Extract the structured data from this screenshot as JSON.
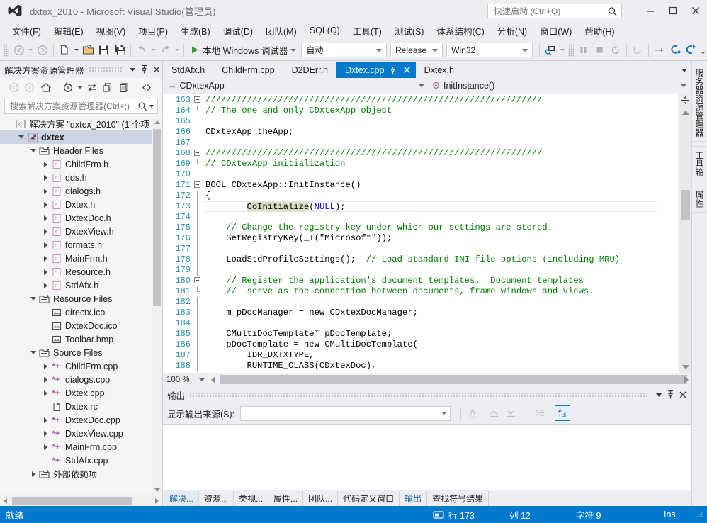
{
  "window": {
    "title": "dxtex_2010 - Microsoft Visual Studio(管理员)",
    "logo_name": "visual-studio-logo"
  },
  "quick_launch": {
    "placeholder": "快速启动 (Ctrl+Q)",
    "value": ""
  },
  "window_buttons": {
    "minimize": "–",
    "maximize": "☐",
    "close": "✕"
  },
  "menu": {
    "items": [
      {
        "label": "文件(F)"
      },
      {
        "label": "编辑(E)"
      },
      {
        "label": "视图(V)"
      },
      {
        "label": "项目(P)"
      },
      {
        "label": "生成(B)"
      },
      {
        "label": "调试(D)"
      },
      {
        "label": "团队(M)"
      },
      {
        "label": "SQL(Q)"
      },
      {
        "label": "工具(T)"
      },
      {
        "label": "测试(S)"
      },
      {
        "label": "体系结构(C)"
      },
      {
        "label": "分析(N)"
      },
      {
        "label": "窗口(W)"
      },
      {
        "label": "帮助(H)"
      }
    ]
  },
  "toolbar": {
    "run_label": "本地 Windows 调试器",
    "config_value": "自动",
    "build_config": "Release",
    "platform": "Win32",
    "icons": [
      "navigate-backward-icon",
      "navigate-forward-icon",
      "new-project-icon",
      "open-file-icon",
      "save-icon",
      "save-all-icon",
      "undo-icon",
      "redo-icon",
      "start-debug-icon",
      "attach-process-icon",
      "pause-icon",
      "stop-icon",
      "restart-icon",
      "hot-reload-icon",
      "step-over-icon",
      "step-into-icon",
      "step-out-icon"
    ]
  },
  "solution_explorer": {
    "title": "解决方案资源管理器",
    "search_placeholder": "搜索解决方案资源管理器(Ctrl+;)",
    "toolbar_icons": [
      "back-icon",
      "forward-icon",
      "home-icon",
      "pending-changes-icon",
      "sync-with-active-document-icon",
      "refresh-icon",
      "collapse-all-icon",
      "show-all-files-icon",
      "properties-icon",
      "overflow-icon"
    ],
    "header_icons": [
      "panel-dropdown-icon",
      "pin-icon",
      "close-icon"
    ],
    "tree": [
      {
        "label": "解决方案 \"dxtex_2010\" (1 个项",
        "depth": 0,
        "icon": "solution-icon",
        "twisty": "none",
        "bold": false,
        "selected": false
      },
      {
        "label": "dxtex",
        "depth": 1,
        "icon": "project-icon",
        "twisty": "down",
        "bold": true,
        "selected": true
      },
      {
        "label": "Header Files",
        "depth": 2,
        "icon": "folder-icon",
        "twisty": "down",
        "bold": false,
        "selected": false
      },
      {
        "label": "ChildFrm.h",
        "depth": 3,
        "icon": "header-file-icon",
        "twisty": "right",
        "bold": false,
        "selected": false
      },
      {
        "label": "dds.h",
        "depth": 3,
        "icon": "header-file-icon",
        "twisty": "right",
        "bold": false,
        "selected": false
      },
      {
        "label": "dialogs.h",
        "depth": 3,
        "icon": "header-file-icon",
        "twisty": "right",
        "bold": false,
        "selected": false
      },
      {
        "label": "Dxtex.h",
        "depth": 3,
        "icon": "header-file-icon",
        "twisty": "right",
        "bold": false,
        "selected": false
      },
      {
        "label": "DxtexDoc.h",
        "depth": 3,
        "icon": "header-file-icon",
        "twisty": "right",
        "bold": false,
        "selected": false
      },
      {
        "label": "DxtexView.h",
        "depth": 3,
        "icon": "header-file-icon",
        "twisty": "right",
        "bold": false,
        "selected": false
      },
      {
        "label": "formats.h",
        "depth": 3,
        "icon": "header-file-icon",
        "twisty": "right",
        "bold": false,
        "selected": false
      },
      {
        "label": "MainFrm.h",
        "depth": 3,
        "icon": "header-file-icon",
        "twisty": "right",
        "bold": false,
        "selected": false
      },
      {
        "label": "Resource.h",
        "depth": 3,
        "icon": "header-file-icon",
        "twisty": "right",
        "bold": false,
        "selected": false
      },
      {
        "label": "StdAfx.h",
        "depth": 3,
        "icon": "header-file-icon",
        "twisty": "right",
        "bold": false,
        "selected": false
      },
      {
        "label": "Resource Files",
        "depth": 2,
        "icon": "folder-icon",
        "twisty": "down",
        "bold": false,
        "selected": false
      },
      {
        "label": "directx.ico",
        "depth": 3,
        "icon": "image-file-icon",
        "twisty": "none",
        "bold": false,
        "selected": false
      },
      {
        "label": "DxtexDoc.ico",
        "depth": 3,
        "icon": "image-file-icon",
        "twisty": "none",
        "bold": false,
        "selected": false
      },
      {
        "label": "Toolbar.bmp",
        "depth": 3,
        "icon": "image-file-icon",
        "twisty": "none",
        "bold": false,
        "selected": false
      },
      {
        "label": "Source Files",
        "depth": 2,
        "icon": "folder-icon",
        "twisty": "down",
        "bold": false,
        "selected": false
      },
      {
        "label": "ChildFrm.cpp",
        "depth": 3,
        "icon": "cpp-file-icon",
        "twisty": "right",
        "bold": false,
        "selected": false
      },
      {
        "label": "dialogs.cpp",
        "depth": 3,
        "icon": "cpp-file-icon",
        "twisty": "right",
        "bold": false,
        "selected": false
      },
      {
        "label": "Dxtex.cpp",
        "depth": 3,
        "icon": "cpp-file-icon",
        "twisty": "right",
        "bold": false,
        "selected": false
      },
      {
        "label": "Dxtex.rc",
        "depth": 3,
        "icon": "resource-file-icon",
        "twisty": "none",
        "bold": false,
        "selected": false
      },
      {
        "label": "DxtexDoc.cpp",
        "depth": 3,
        "icon": "cpp-file-icon",
        "twisty": "right",
        "bold": false,
        "selected": false
      },
      {
        "label": "DxtexView.cpp",
        "depth": 3,
        "icon": "cpp-file-icon",
        "twisty": "right",
        "bold": false,
        "selected": false
      },
      {
        "label": "MainFrm.cpp",
        "depth": 3,
        "icon": "cpp-file-icon",
        "twisty": "right",
        "bold": false,
        "selected": false
      },
      {
        "label": "StdAfx.cpp",
        "depth": 3,
        "icon": "cpp-file-icon",
        "twisty": "none",
        "bold": false,
        "selected": false
      },
      {
        "label": "外部依赖项",
        "depth": 2,
        "icon": "folder-icon",
        "twisty": "right",
        "bold": false,
        "selected": false
      }
    ]
  },
  "editor": {
    "tabs": [
      {
        "label": "StdAfx.h",
        "active": false
      },
      {
        "label": "ChildFrm.cpp",
        "active": false
      },
      {
        "label": "D2DErr.h",
        "active": false
      },
      {
        "label": "Dxtex.cpp",
        "active": true
      },
      {
        "label": "Dxtex.h",
        "active": false
      }
    ],
    "tab_pin_icon": "pin-icon",
    "tab_close_icon": "close-icon",
    "tab_overflow_icon": "tab-list-dropdown-icon",
    "nav_class": "CDxtexApp",
    "nav_member": "InitInstance()",
    "zoom": "100 %",
    "first_line": 163,
    "lines": [
      {
        "no": 163,
        "fold": "box",
        "text": "/////////////////////////////////////////////////////////////////"
      },
      {
        "no": 164,
        "fold": "end",
        "text": "// The one and only CDxtexApp object"
      },
      {
        "no": 165,
        "fold": "",
        "text": ""
      },
      {
        "no": 166,
        "fold": "",
        "text": "CDxtexApp theApp;"
      },
      {
        "no": 167,
        "fold": "",
        "text": ""
      },
      {
        "no": 168,
        "fold": "box",
        "text": "/////////////////////////////////////////////////////////////////"
      },
      {
        "no": 169,
        "fold": "end",
        "text": "// CDxtexApp initialization"
      },
      {
        "no": 170,
        "fold": "",
        "text": ""
      },
      {
        "no": 171,
        "fold": "box",
        "text": "BOOL CDxtexApp::InitInstance()"
      },
      {
        "no": 172,
        "fold": "line",
        "text": "{"
      },
      {
        "no": 173,
        "fold": "line",
        "text": "    CoInitialize(NULL);"
      },
      {
        "no": 174,
        "fold": "line",
        "text": ""
      },
      {
        "no": 175,
        "fold": "line",
        "text": "    // Change the registry key under which our settings are stored."
      },
      {
        "no": 176,
        "fold": "line",
        "text": "    SetRegistryKey(_T(\"Microsoft\"));"
      },
      {
        "no": 177,
        "fold": "line",
        "text": ""
      },
      {
        "no": 178,
        "fold": "line",
        "text": "    LoadStdProfileSettings();  // Load standard INI file options (including MRU)"
      },
      {
        "no": 179,
        "fold": "line",
        "text": ""
      },
      {
        "no": 180,
        "fold": "box",
        "text": "    // Register the application's document templates.  Document templates"
      },
      {
        "no": 181,
        "fold": "end",
        "text": "    //  serve as the connection between documents, frame windows and views."
      },
      {
        "no": 182,
        "fold": "line",
        "text": ""
      },
      {
        "no": 183,
        "fold": "line",
        "text": "    m_pDocManager = new CDxtexDocManager;"
      },
      {
        "no": 184,
        "fold": "line",
        "text": ""
      },
      {
        "no": 185,
        "fold": "line",
        "text": "    CMultiDocTemplate* pDocTemplate;"
      },
      {
        "no": 186,
        "fold": "line",
        "text": "    pDocTemplate = new CMultiDocTemplate("
      },
      {
        "no": 187,
        "fold": "line",
        "text": "        IDR_DXTXTYPE,"
      },
      {
        "no": 188,
        "fold": "line",
        "text": "        RUNTIME_CLASS(CDxtexDoc),"
      }
    ],
    "cursor": {
      "line": 173,
      "col": 12
    },
    "highlighted_word": "CoInitialize"
  },
  "output_panel": {
    "title": "输出",
    "source_label": "显示输出来源(S):",
    "source_value": "",
    "header_icons": [
      "panel-dropdown-icon",
      "pin-icon",
      "close-icon"
    ],
    "toolbar_icons": [
      "clear-all-icon",
      "goto-previous-message-icon",
      "goto-next-message-icon",
      "toggle-output-wrap-icon",
      "word-wrap-icon"
    ],
    "content": ""
  },
  "bottom_tabs": [
    {
      "label": "解决...",
      "state": "selected"
    },
    {
      "label": "资源...",
      "state": "normal"
    },
    {
      "label": "类视...",
      "state": "normal"
    },
    {
      "label": "属性...",
      "state": "normal"
    },
    {
      "label": "团队...",
      "state": "normal"
    },
    {
      "label": "代码定义窗口",
      "state": "normal"
    },
    {
      "label": "输出",
      "state": "link"
    },
    {
      "label": "查找符号结果",
      "state": "normal"
    }
  ],
  "right_tabs": [
    {
      "label": "服务器资源管理器"
    },
    {
      "label": "工具箱"
    },
    {
      "label": "属性"
    }
  ],
  "status_bar": {
    "ready": "就绪",
    "line_label": "行 173",
    "col_label": "列 12",
    "char_label": "字符 9",
    "insert_mode": "Ins",
    "caret_icon": "caret-position-icon"
  },
  "colors": {
    "accent": "#007acc",
    "chrome": "#eeeef2",
    "panel": "#f5f5f5",
    "selection": "#cbd6e5",
    "comment": "#008000",
    "keyword": "#0000ff",
    "type": "#2b91af",
    "string": "#a31515",
    "macro": "#6f008a"
  }
}
